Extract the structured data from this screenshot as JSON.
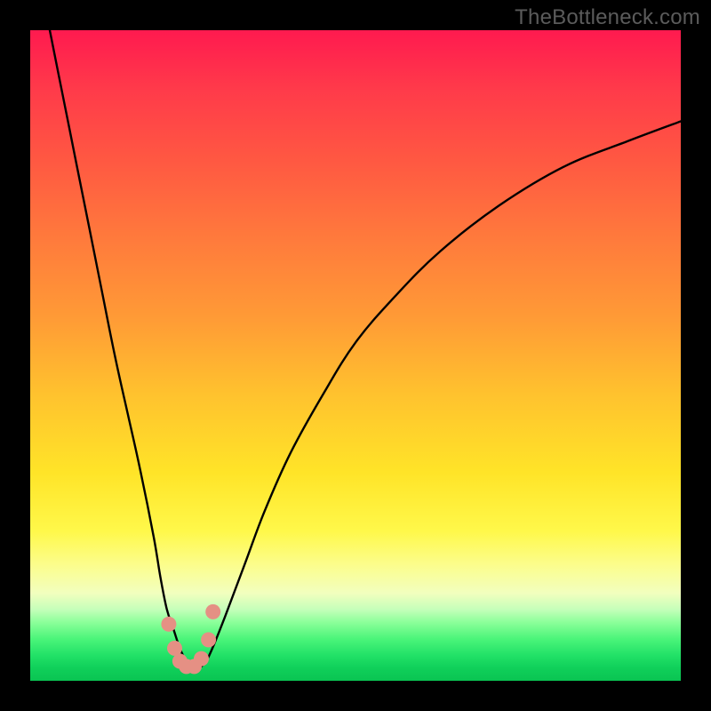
{
  "watermark": {
    "text": "TheBottleneck.com"
  },
  "colors": {
    "background": "#000000",
    "curve_stroke": "#000000",
    "marker_fill": "#e59084",
    "gradient_top": "#ff1a4f",
    "gradient_bottom": "#0ac452"
  },
  "chart_data": {
    "type": "line",
    "title": "",
    "xlabel": "",
    "ylabel": "",
    "xlim": [
      0,
      100
    ],
    "ylim": [
      0,
      100
    ],
    "grid": false,
    "legend": false,
    "series": [
      {
        "name": "bottleneck-curve",
        "x": [
          3,
          5,
          7,
          9,
          11,
          13,
          15,
          17,
          19,
          20,
          21,
          22,
          23,
          24,
          25,
          26,
          27,
          28,
          30,
          33,
          36,
          40,
          45,
          50,
          56,
          63,
          72,
          82,
          92,
          100
        ],
        "y": [
          100,
          90,
          80,
          70,
          60,
          50,
          41,
          32,
          22,
          16,
          11,
          8,
          5,
          3,
          2,
          2,
          3,
          5,
          10,
          18,
          26,
          35,
          44,
          52,
          59,
          66,
          73,
          79,
          83,
          86
        ]
      }
    ],
    "markers": {
      "name": "optimum-points",
      "x": [
        21.3,
        22.2,
        23.0,
        24.0,
        25.2,
        26.3,
        27.4,
        28.1
      ],
      "y": [
        8.7,
        5.0,
        3.0,
        2.2,
        2.2,
        3.4,
        6.3,
        10.6
      ]
    },
    "background_gradient": {
      "orientation": "vertical",
      "meaning": "red=high bottleneck, green=low bottleneck",
      "stops": [
        {
          "pos": 0.0,
          "color": "#ff1a4f"
        },
        {
          "pos": 0.2,
          "color": "#ff5842"
        },
        {
          "pos": 0.44,
          "color": "#ff9a36"
        },
        {
          "pos": 0.68,
          "color": "#ffe428"
        },
        {
          "pos": 0.86,
          "color": "#f2ffbe"
        },
        {
          "pos": 1.0,
          "color": "#0ac452"
        }
      ]
    }
  }
}
